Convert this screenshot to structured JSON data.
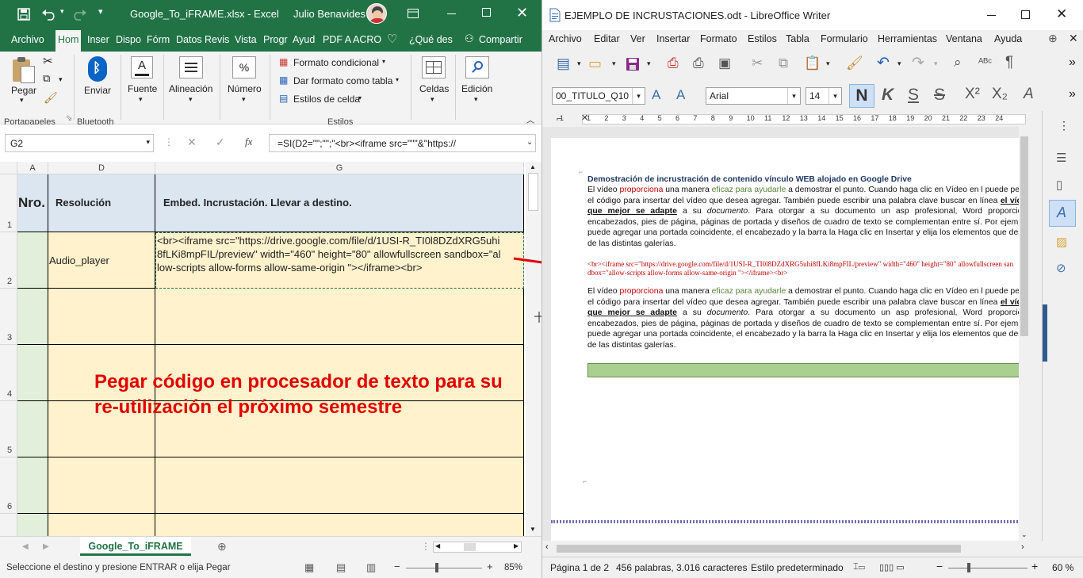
{
  "excel": {
    "title": "Google_To_iFRAME.xlsx - Excel",
    "user": "Julio Benavides",
    "tabs": [
      "Archivo",
      "Hom",
      "Inser",
      "Dispo",
      "Fórm",
      "Datos",
      "Revis",
      "Vista",
      "Progr",
      "Ayud",
      "PDF A",
      "ACRO"
    ],
    "tell_me": "¿Qué des",
    "share": "Compartir",
    "ribbon": {
      "paste": "Pegar",
      "send": "Enviar",
      "font": "Fuente",
      "alignment": "Alineación",
      "number": "Número",
      "number_symbol": "%",
      "conditional": "Formato condicional",
      "table_format": "Dar formato como tabla",
      "cell_styles": "Estilos de celda",
      "cells": "Celdas",
      "editing": "Edición",
      "groups": {
        "clipboard": "Portapapeles",
        "bluetooth": "Bluetooth",
        "styles": "Estilos"
      }
    },
    "name_box": "G2",
    "formula": "=SI(D2=\"\";\"\";\"<br><iframe src=\"\"\"&\"https://",
    "columns": [
      "A",
      "D",
      "G"
    ],
    "rows": [
      "1",
      "2",
      "3",
      "4",
      "5",
      "6"
    ],
    "header_cells": {
      "a": "Nro.",
      "d": "Resolución",
      "g": "Embed. Incrustación. Llevar a destino."
    },
    "d2": "Audio_player",
    "g2": "<br><iframe src=\"https://drive.google.com/file/d/1USI-R_TI0l8DZdXRG5uhi8fLKi8mpFIL/preview\" width=\"460\" height=\"80\" allowfullscreen sandbox=\"allow-scripts allow-forms allow-same-origin \"></iframe><br>",
    "overlay_text": "Pegar código en procesador de texto para su re-utilización el próximo semestre",
    "sheet_tab": "Google_To_iFRAME",
    "status": "Seleccione el destino y presione ENTRAR o elija Pegar",
    "zoom": "85%"
  },
  "writer": {
    "title": "EJEMPLO DE INCRUSTACIONES.odt - LibreOffice Writer",
    "menu": [
      "Archivo",
      "Editar",
      "Ver",
      "Insertar",
      "Formato",
      "Estilos",
      "Tabla",
      "Formulario",
      "Herramientas",
      "Ventana",
      "Ayuda"
    ],
    "para_style": "00_TITULO_Q10",
    "font_name": "Arial",
    "font_size": "14",
    "bold": "N",
    "italic": "K",
    "strike": "S",
    "ruler_numbers": [
      "1",
      "1",
      "2",
      "3",
      "4",
      "5",
      "6",
      "7",
      "8",
      "9",
      "10",
      "11",
      "12",
      "13",
      "14",
      "15",
      "16",
      "17",
      "18",
      "19",
      "20",
      "21",
      "22",
      "23",
      "24"
    ],
    "heading": "Demostración de incrustración de contenido vínculo WEB alojado en Google Drive",
    "paragraph_parts": [
      "El vídeo ",
      "proporciona",
      " una manera ",
      "eficaz para ayudarle",
      " a demostrar el punto. Cuando haga clic en Vídeo en l puede pegar el código para insertar del vídeo que desea agregar. También puede escribir una palabra clave buscar en línea ",
      "el vídeo que mejor se adapte",
      " a su ",
      "documento",
      ". Para otorgar a su documento un asp profesional, Word proporciona encabezados, pies de página, páginas de portada y diseños de cuadro de texto se complementan entre sí. Por ejemplo, puede agregar una portada coincidente, el encabezado y la barra la Haga clic en Insertar y elija los elementos que desee de las distintas galerías."
    ],
    "iframe_code": "<br><iframe src=\"https://drive.google.com/file/d/1USI-R_TI0l8DZdXRG5uhi8fLKi8mpFIL/preview\" width=\"460\" height=\"80\" allowfullscreen sandbox=\"allow-scripts allow-forms allow-same-origin \"></iframe><br>",
    "status": {
      "page": "Página 1 de 2",
      "words": "456 palabras, 3.016 caracteres",
      "style": "Estilo predeterminado",
      "zoom": "60 %"
    }
  },
  "colors": {
    "excel_green": "#217346",
    "header_blue": "#dce6f1",
    "cell_yellow": "#fff2cc",
    "row_green": "#e2efda",
    "red": "#e00000",
    "writer_green_bar": "#a9d08e"
  }
}
